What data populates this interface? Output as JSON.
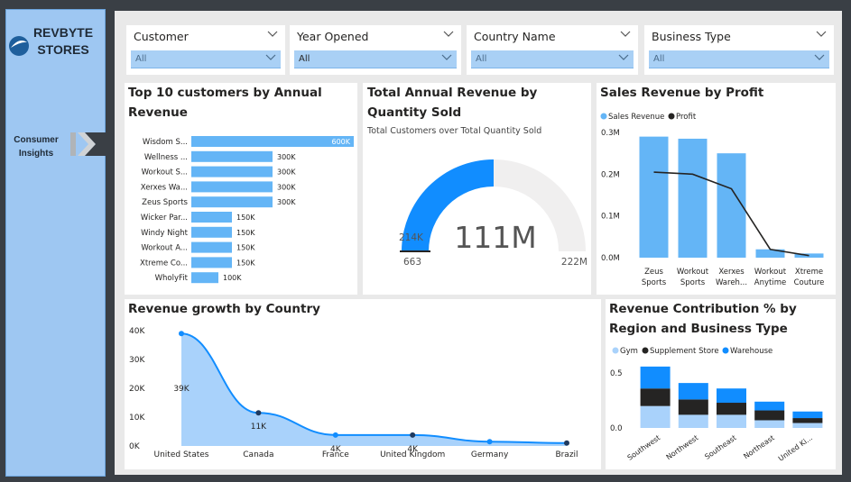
{
  "sidebar": {
    "logo_line1": "REVBYTE",
    "logo_line2": "STORES",
    "nav_line1": "Consumer",
    "nav_line2": "Insights"
  },
  "slicers": [
    {
      "title": "Customer",
      "value": "All"
    },
    {
      "title": "Year Opened",
      "value": "All"
    },
    {
      "title": "Country Name",
      "value": "All"
    },
    {
      "title": "Business Type",
      "value": "All"
    }
  ],
  "colors": {
    "accent": "#118dff",
    "bar": "#64b5f6",
    "dark": "#252423",
    "area": "#a9d2fb",
    "gauge_bg": "#f0efef"
  },
  "charts": {
    "top_customers": {
      "title": "Top 10 customers by Annual Revenue",
      "chart_data": {
        "type": "bar",
        "orientation": "horizontal",
        "categories": [
          "Wisdom S...",
          "Wellness ...",
          "Workout S...",
          "Xerxes Wa...",
          "Zeus Sports",
          "Wicker Par...",
          "Windy Night",
          "Workout A...",
          "Xtreme Co...",
          "WholyFit"
        ],
        "values": [
          600000,
          300000,
          300000,
          300000,
          300000,
          150000,
          150000,
          150000,
          150000,
          100000
        ],
        "labels": [
          "600K",
          "300K",
          "300K",
          "300K",
          "300K",
          "150K",
          "150K",
          "150K",
          "150K",
          "100K"
        ]
      }
    },
    "gauge": {
      "title": "Total Annual Revenue by Quantity Sold",
      "subtitle": "Total Customers over Total Quantity Sold",
      "chart_data": {
        "type": "gauge",
        "value": 111,
        "value_label": "111M",
        "min": 0,
        "min_label": "663",
        "max": 222,
        "max_label": "222M",
        "target_label": "214K"
      }
    },
    "sales_profit": {
      "title": "Sales Revenue by Profit",
      "legend": [
        "Sales Revenue",
        "Profit"
      ],
      "chart_data": {
        "type": "bar",
        "categories": [
          [
            "Zeus",
            "Sports"
          ],
          [
            "Workout",
            "Sports"
          ],
          [
            "Xerxes",
            "Wareh..."
          ],
          [
            "Workout",
            "Anytime"
          ],
          [
            "Xtreme",
            "Couture"
          ]
        ],
        "series": [
          {
            "name": "Sales Revenue",
            "type": "bar",
            "values": [
              0.29,
              0.285,
              0.25,
              0.02,
              0.01
            ]
          },
          {
            "name": "Profit",
            "type": "line",
            "values": [
              0.205,
              0.2,
              0.165,
              0.02,
              0.005
            ]
          }
        ],
        "yticks": [
          "0.0M",
          "0.1M",
          "0.2M",
          "0.3M"
        ],
        "ylim": [
          0,
          0.3
        ]
      }
    },
    "revenue_growth": {
      "title": "Revenue growth by Country",
      "chart_data": {
        "type": "area",
        "categories": [
          "United States",
          "Canada",
          "France",
          "United Kingdom",
          "Germany",
          "Brazil"
        ],
        "values": [
          39000,
          11500,
          3800,
          3800,
          1500,
          1000
        ],
        "labels": [
          "39K",
          "11K",
          "4K",
          "4K",
          "",
          ""
        ],
        "yticks": [
          "0K",
          "10K",
          "20K",
          "30K",
          "40K"
        ],
        "ylim": [
          0,
          40000
        ]
      }
    },
    "region_contrib": {
      "title": "Revenue Contribution % by Region and Business Type",
      "legend": [
        "Gym",
        "Supplement Store",
        "Warehouse"
      ],
      "chart_data": {
        "type": "bar",
        "stacked": true,
        "categories": [
          "Southwest",
          "Northwest",
          "Southeast",
          "Northeast",
          "United Ki..."
        ],
        "series": [
          {
            "name": "Gym",
            "values": [
              0.2,
              0.12,
              0.12,
              0.07,
              0.045
            ]
          },
          {
            "name": "Supplement Store",
            "values": [
              0.16,
              0.14,
              0.11,
              0.09,
              0.045
            ]
          },
          {
            "name": "Warehouse",
            "values": [
              0.2,
              0.15,
              0.13,
              0.08,
              0.06
            ]
          }
        ],
        "yticks": [
          "0.0",
          "0.5"
        ],
        "ylim": [
          0,
          0.6
        ]
      }
    }
  }
}
